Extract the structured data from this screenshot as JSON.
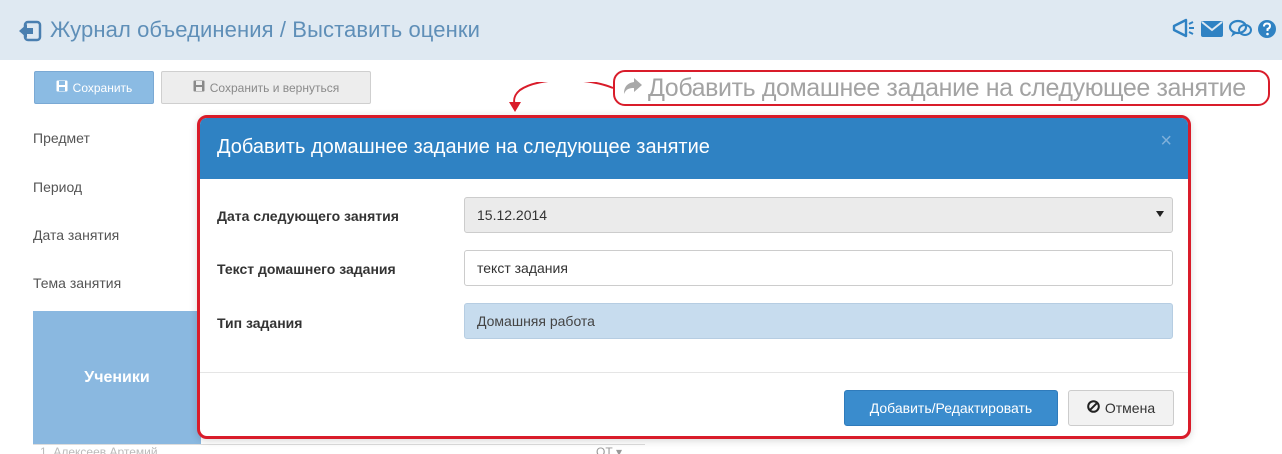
{
  "header": {
    "title": "Журнал объединения / Выставить оценки",
    "icons": [
      "back-icon",
      "megaphone-icon",
      "envelope-icon",
      "chat-icon",
      "help-icon"
    ]
  },
  "toolbar": {
    "save_label": "Сохранить",
    "save_back_label": "Сохранить и вернуться"
  },
  "callout": {
    "text": "Добавить домашнее задание на следующее занятие",
    "color": "#d91c2a"
  },
  "form_labels": {
    "subject": "Предмет",
    "period": "Период",
    "lesson_date": "Дата занятия",
    "lesson_topic": "Тема занятия"
  },
  "table": {
    "students_header": "Ученики",
    "first_row": "1. Алексеев Артемий",
    "first_row_select": "ОТ"
  },
  "modal": {
    "title": "Добавить домашнее задание на следующее занятие",
    "close": "×",
    "fields": {
      "next_date_label": "Дата следующего занятия",
      "next_date_value": "15.12.2014",
      "hw_text_label": "Текст домашнего задания",
      "hw_text_value": "текст задания",
      "task_type_label": "Тип задания",
      "task_type_value": "Домашняя работа"
    },
    "add_button": "Добавить/Редактировать",
    "cancel_button": "Отмена"
  },
  "colors": {
    "header_bg": "#dfe9f2",
    "modal_header": "#2f82c3",
    "primary_button": "#3a8ccd",
    "highlight_border": "#d91c2a"
  }
}
